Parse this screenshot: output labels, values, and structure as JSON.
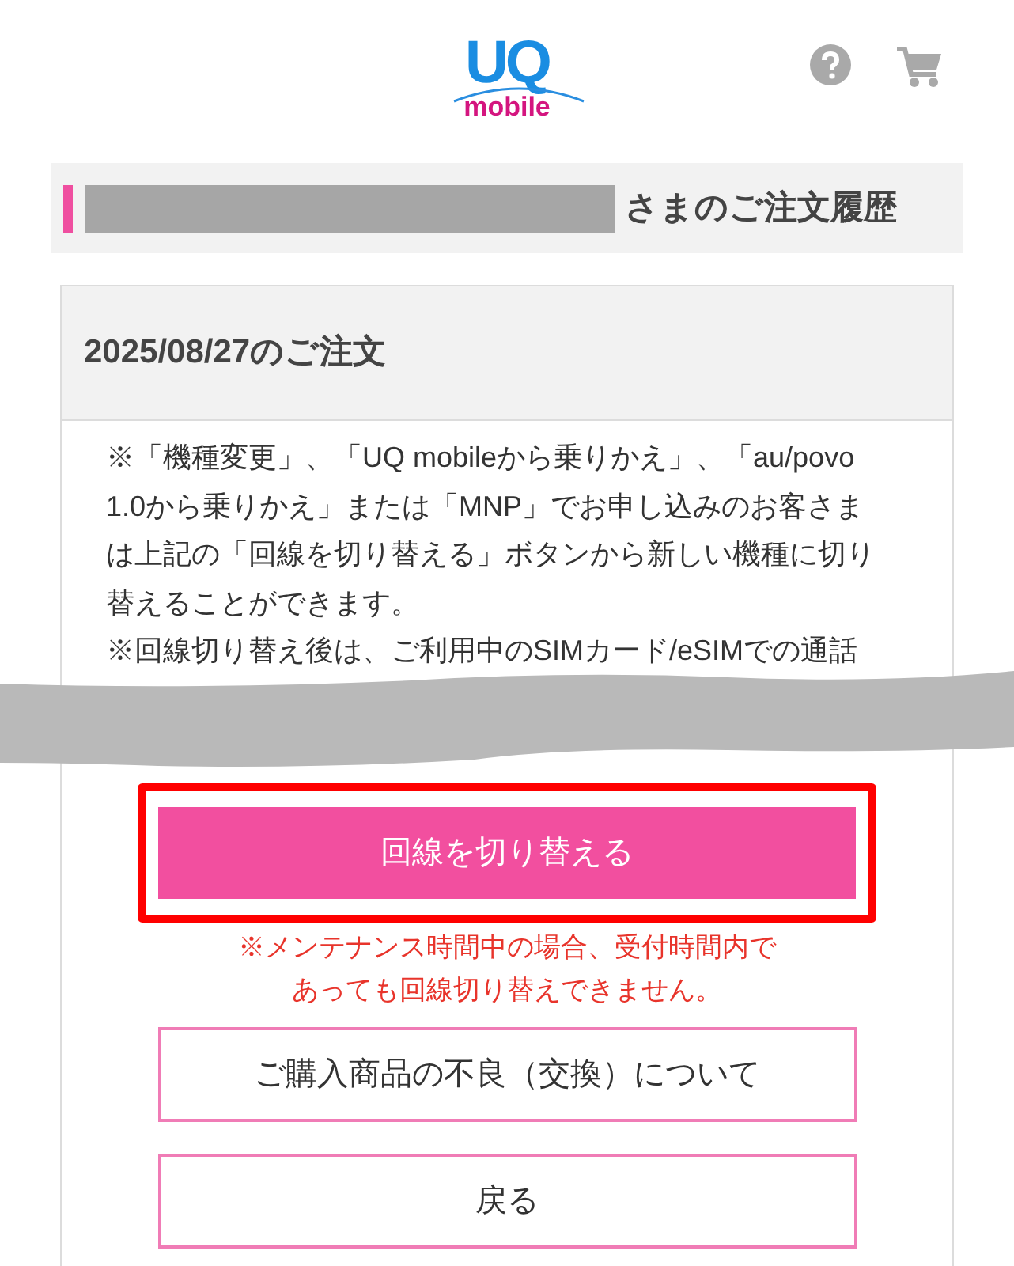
{
  "header": {
    "logo": {
      "top": "UQ",
      "bottom": "mobile"
    }
  },
  "page_title": {
    "suffix": "さまのご注文履歴"
  },
  "order": {
    "date_heading": "2025/08/27のご注文",
    "note_lines": [
      "※「機種変更」、「UQ mobileから乗りかえ」、「au/povo",
      "1.0から乗りかえ」または「MNP」でお申し込みのお客さま",
      "は上記の「回線を切り替える」ボタンから新しい機種に切り",
      "替えることができます。",
      "※回線切り替え後は、ご利用中のSIMカード/eSIMでの通話"
    ],
    "primary_button": "回線を切り替える",
    "warning_lines": [
      "※メンテナンス時間中の場合、受付時間内で",
      "あっても回線切り替えできません。"
    ],
    "buttons": [
      "ご購入商品の不良（交換）について",
      "戻る"
    ]
  }
}
